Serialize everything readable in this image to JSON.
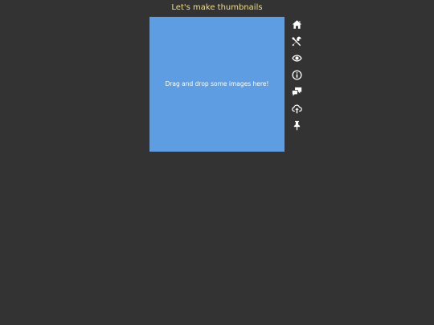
{
  "header": {
    "title": "Let's make thumbnails"
  },
  "dropzone": {
    "text": "Drag and drop some images here!"
  },
  "toolbar": {
    "items": [
      {
        "icon": "home-icon"
      },
      {
        "icon": "tools-icon"
      },
      {
        "icon": "eye-icon"
      },
      {
        "icon": "info-icon"
      },
      {
        "icon": "comments-icon"
      },
      {
        "icon": "cloud-upload-icon"
      },
      {
        "icon": "pin-icon"
      }
    ]
  },
  "colors": {
    "background": "#333333",
    "title": "#f2dd8a",
    "dropzone": "#5e9de2",
    "icon": "#ffffff"
  }
}
